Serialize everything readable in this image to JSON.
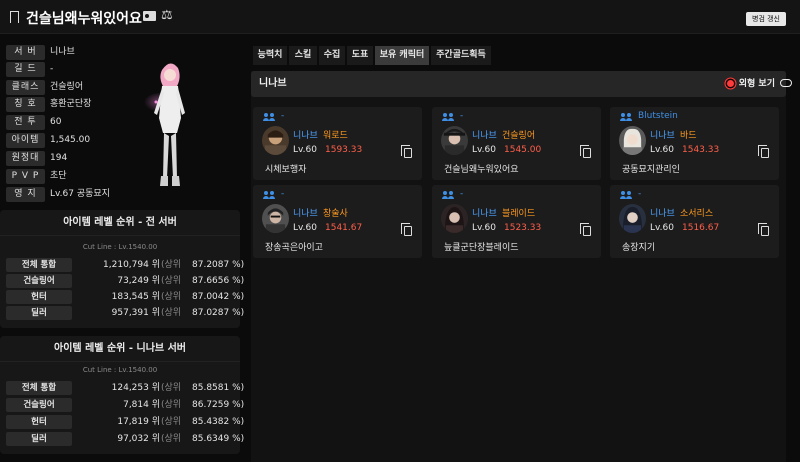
{
  "header": {
    "title": "건슬님왜누워있어요",
    "refresh_label": "병검 갱신"
  },
  "profile": {
    "rows": [
      {
        "label": "서 버",
        "value": "니나브"
      },
      {
        "label": "길 드",
        "value": "-"
      },
      {
        "label": "클래스",
        "value": "건슬링어"
      },
      {
        "label": "칭 호",
        "value": "홍환군단장"
      },
      {
        "label": "전 투",
        "value": "60"
      },
      {
        "label": "아이템",
        "value": "1,545.00"
      },
      {
        "label": "원정대",
        "value": "194"
      },
      {
        "label": "P V P",
        "value": "초단"
      },
      {
        "label": "영 지",
        "value": "Lv.67 공동묘지"
      }
    ]
  },
  "rank_all": {
    "title": "아이템 레벨 순위 - 전 서버",
    "cutline": "Cut Line : Lv.1540.00",
    "rows": [
      {
        "label": "전체 통합",
        "rank": "1,210,794 위",
        "pre": "(상위",
        "pct": "87.2087 %)"
      },
      {
        "label": "건슬링어",
        "rank": "73,249 위",
        "pre": "(상위",
        "pct": "87.6656 %)"
      },
      {
        "label": "헌터",
        "rank": "183,545 위",
        "pre": "(상위",
        "pct": "87.0042 %)"
      },
      {
        "label": "딜러",
        "rank": "957,391 위",
        "pre": "(상위",
        "pct": "87.0287 %)"
      }
    ]
  },
  "rank_server": {
    "title": "아이템 레벨 순위 - 니나브 서버",
    "cutline": "Cut Line : Lv.1540.00",
    "rows": [
      {
        "label": "전체 통합",
        "rank": "124,253 위",
        "pre": "(상위",
        "pct": "85.8581 %)"
      },
      {
        "label": "건슬링어",
        "rank": "7,814 위",
        "pre": "(상위",
        "pct": "86.7259 %)"
      },
      {
        "label": "헌터",
        "rank": "17,819 위",
        "pre": "(상위",
        "pct": "85.4382 %)"
      },
      {
        "label": "딜러",
        "rank": "97,032 위",
        "pre": "(상위",
        "pct": "85.6349 %)"
      }
    ]
  },
  "tabs": [
    "능력치",
    "스킬",
    "수집",
    "도표",
    "보유 캐릭터",
    "주간골드획득"
  ],
  "active_tab": "보유 캐릭터",
  "characters_panel": {
    "server": "니나브",
    "outfit_view_label": "외형 보기",
    "cards": [
      {
        "guild": "-",
        "server": "니나브",
        "class": "워로드",
        "level": "Lv.60",
        "item_level": "1593.33",
        "name": "시체보행자"
      },
      {
        "guild": "-",
        "server": "니나브",
        "class": "건슬링어",
        "level": "Lv.60",
        "item_level": "1545.00",
        "name": "건슬님왜누워있어요"
      },
      {
        "guild": "Blutstein",
        "server": "니나브",
        "class": "바드",
        "level": "Lv.60",
        "item_level": "1543.33",
        "name": "공동묘지관리인"
      },
      {
        "guild": "-",
        "server": "니나브",
        "class": "창술사",
        "level": "Lv.60",
        "item_level": "1541.67",
        "name": "장송곡은아이고"
      },
      {
        "guild": "-",
        "server": "니나브",
        "class": "블레이드",
        "level": "Lv.60",
        "item_level": "1523.33",
        "name": "늪클군단장블레이드"
      },
      {
        "guild": "-",
        "server": "니나브",
        "class": "소서리스",
        "level": "Lv.60",
        "item_level": "1516.67",
        "name": "송장지기"
      }
    ]
  },
  "colors": {
    "guild": "#3f8fe6",
    "server": "#4ea3ff",
    "class": "#ff9a1f",
    "item_level": "#ff5f4a"
  }
}
